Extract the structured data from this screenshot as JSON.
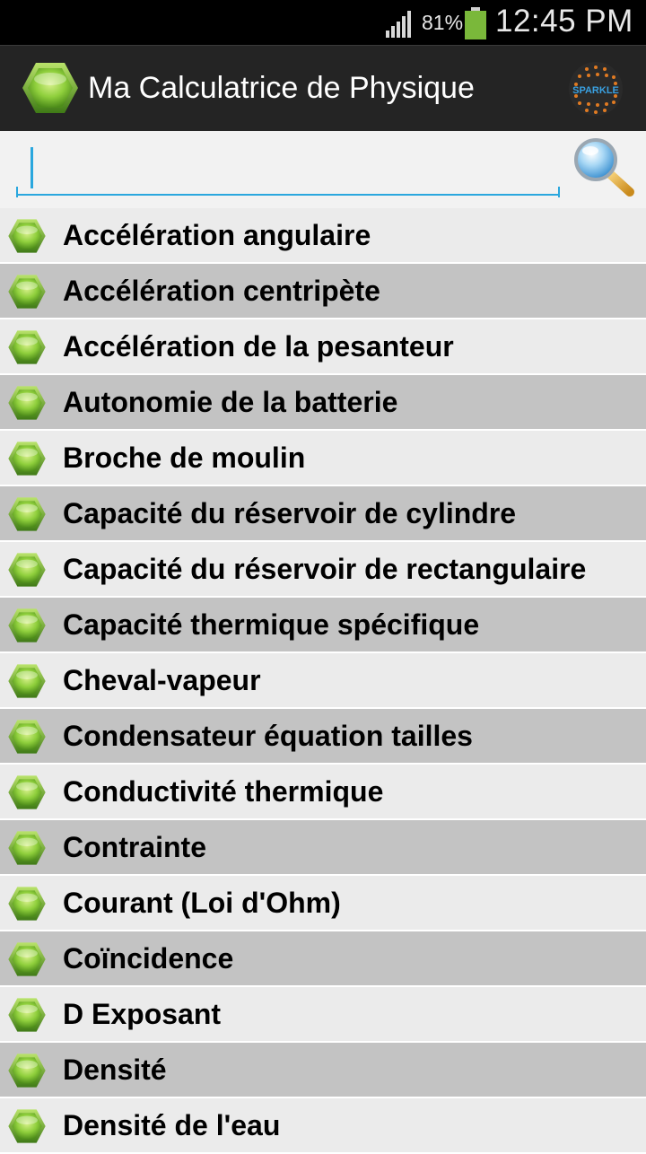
{
  "status_bar": {
    "battery_percent": "81%",
    "time": "12:45 PM",
    "signal_icon": "signal-bars-icon",
    "battery_icon": "battery-icon"
  },
  "app": {
    "title": "Ma Calculatrice de Physique",
    "logo_icon": "green-hexagon-icon",
    "brand_logo_text": "SPARKLE"
  },
  "search": {
    "value": "",
    "placeholder": "",
    "button_icon": "magnifier-icon"
  },
  "colors": {
    "accent": "#2aa7de",
    "row_light": "#ebebeb",
    "row_dark": "#c3c3c3",
    "hexagon_green": "#7fc241"
  },
  "list": {
    "items": [
      {
        "label": "Accélération angulaire"
      },
      {
        "label": "Accélération centripète"
      },
      {
        "label": "Accélération de la pesanteur"
      },
      {
        "label": "Autonomie de la batterie"
      },
      {
        "label": "Broche de moulin"
      },
      {
        "label": "Capacité du réservoir de cylindre"
      },
      {
        "label": "Capacité du réservoir de rectangulaire"
      },
      {
        "label": "Capacité thermique spécifique"
      },
      {
        "label": "Cheval-vapeur"
      },
      {
        "label": "Condensateur équation tailles"
      },
      {
        "label": "Conductivité thermique"
      },
      {
        "label": "Contrainte"
      },
      {
        "label": "Courant (Loi d'Ohm)"
      },
      {
        "label": "Coïncidence"
      },
      {
        "label": "D Exposant"
      },
      {
        "label": "Densité"
      },
      {
        "label": "Densité de l'eau"
      }
    ]
  }
}
